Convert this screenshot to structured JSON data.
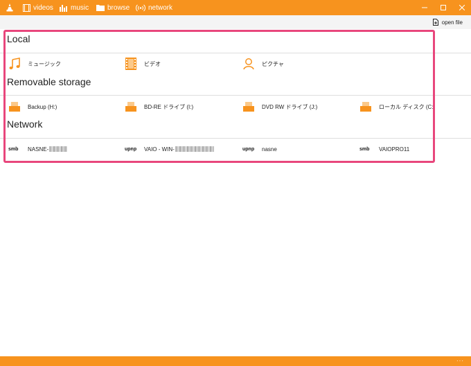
{
  "nav": {
    "videos": "videos",
    "music": "music",
    "browse": "browse",
    "network": "network"
  },
  "toolbar": {
    "open_file": "open file"
  },
  "local": {
    "title": "Local",
    "items": [
      {
        "label": "ミュージック",
        "icon": "music-note-icon"
      },
      {
        "label": "ビデオ",
        "icon": "film-icon"
      },
      {
        "label": "ピクチャ",
        "icon": "person-icon"
      }
    ]
  },
  "removable": {
    "title": "Removable storage",
    "items": [
      {
        "label": "Backup (H:)",
        "icon": "drive-icon"
      },
      {
        "label": "BD-RE ドライブ (I:)",
        "icon": "drive-icon"
      },
      {
        "label": "DVD RW ドライブ (J:)",
        "icon": "drive-icon"
      },
      {
        "label": "ローカル ディスク (C:)",
        "icon": "drive-icon"
      }
    ]
  },
  "network": {
    "title": "Network",
    "items": [
      {
        "tag": "smb",
        "label": "NASNE-"
      },
      {
        "tag": "upnp",
        "label": "VAIO - WIN-"
      },
      {
        "tag": "upnp",
        "label": "nasne"
      },
      {
        "tag": "smb",
        "label": "VAIOPRO11"
      }
    ]
  },
  "status": {
    "more": "···"
  },
  "colors": {
    "accent": "#f7931e",
    "highlight": "#e8467c"
  }
}
